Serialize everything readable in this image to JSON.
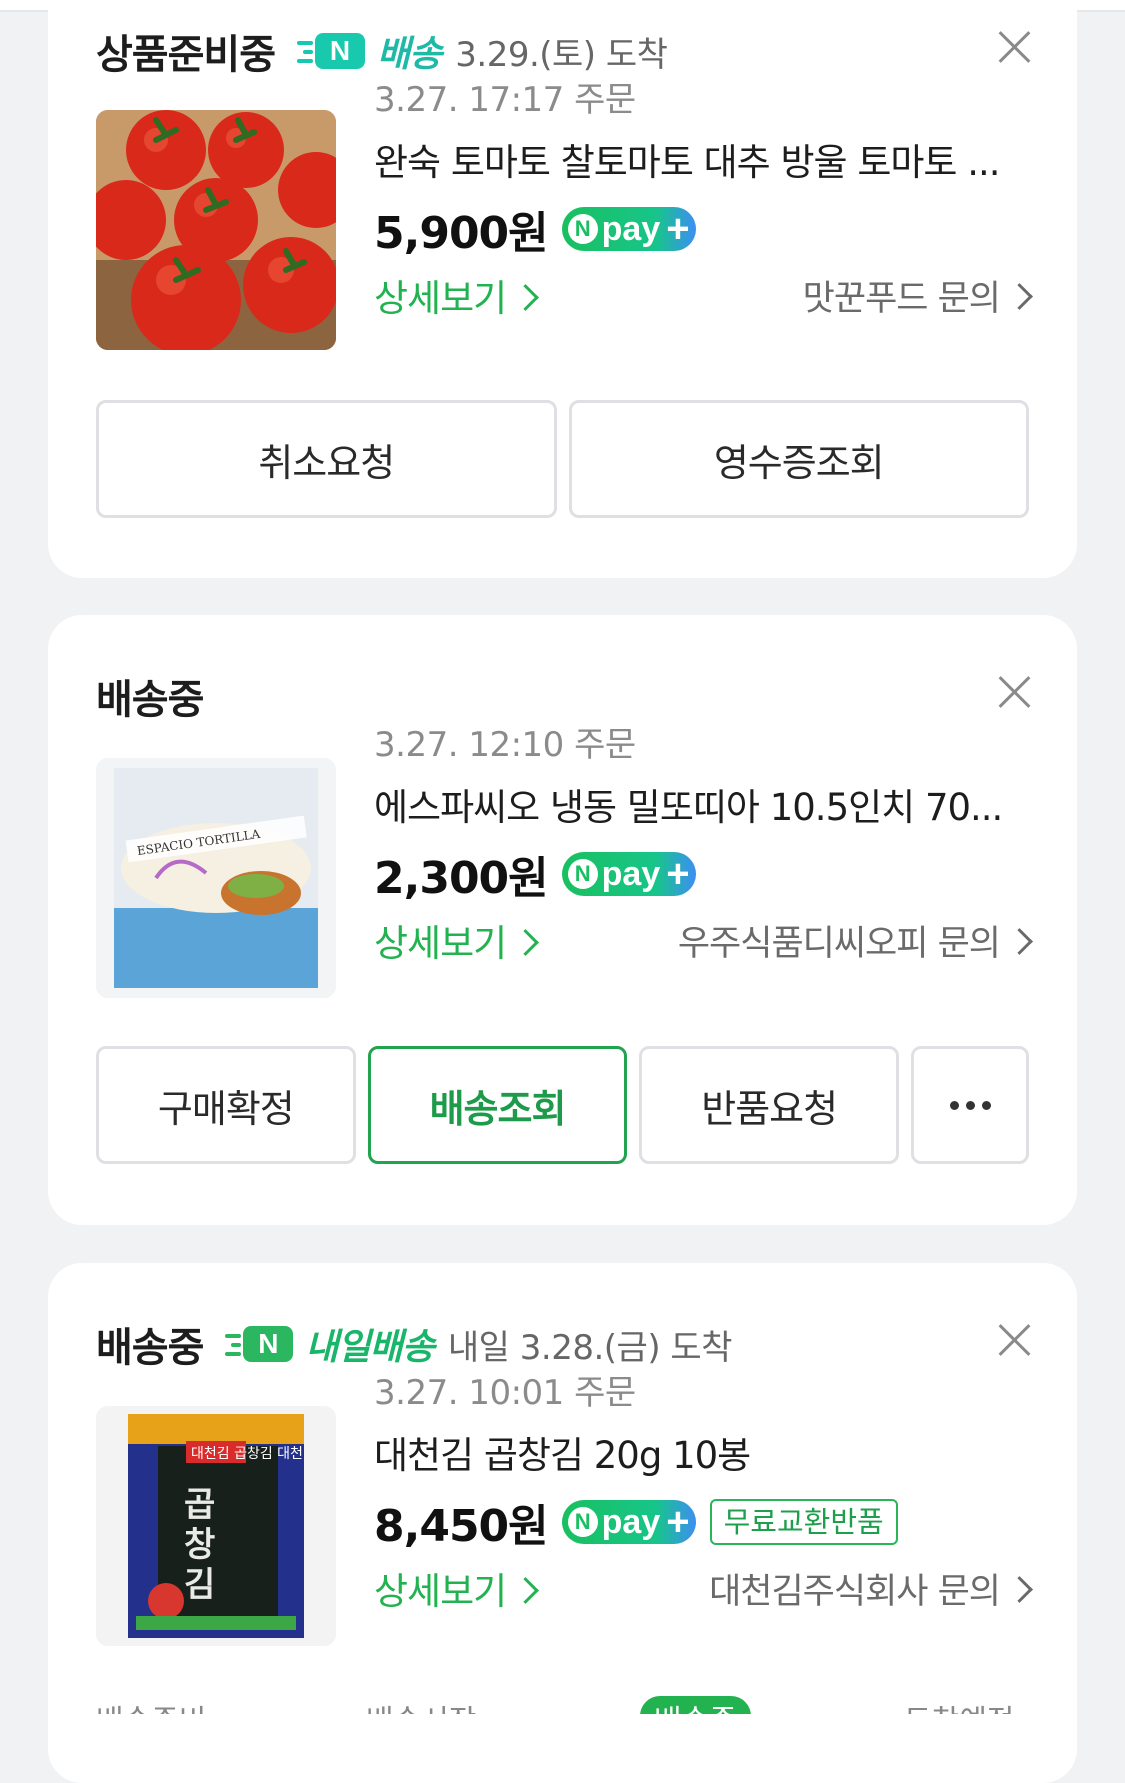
{
  "orders": [
    {
      "status": "상품준비중",
      "delivery_badge": "배송",
      "arrival": "3.29.(토) 도착",
      "order_time": "3.27. 17:17 주문",
      "product_name": "완숙 토마토 찰토마토 대추 방울 토마토 ...",
      "price": "5,900원",
      "detail_label": "상세보기",
      "seller_inquiry": "맛꾼푸드 문의",
      "buttons": [
        "취소요청",
        "영수증조회"
      ]
    },
    {
      "status": "배송중",
      "order_time": "3.27. 12:10 주문",
      "product_name": "에스파씨오 냉동 밀또띠아 10.5인치 70...",
      "price": "2,300원",
      "detail_label": "상세보기",
      "seller_inquiry": "우주식품디씨오피 문의",
      "buttons": [
        "구매확정",
        "배송조회",
        "반품요청"
      ],
      "packaging_text": "ESPACIO TORTILLA"
    },
    {
      "status": "배송중",
      "delivery_badge": "내일배송",
      "arrival": "내일 3.28.(금) 도착",
      "order_time": "3.27. 10:01 주문",
      "product_name": "대천김 곱창김 20g 10봉",
      "price": "8,450원",
      "extra_badge": "무료교환반품",
      "detail_label": "상세보기",
      "seller_inquiry": "대천김주식회사 문의",
      "packaging_text": "대천김 곱창김 대천"
    }
  ],
  "npay": {
    "n": "N",
    "label": "pay",
    "plus": "+"
  },
  "ship_icon_letter": "N",
  "bottom_steps": [
    "배송준비",
    "배송시작",
    "배송중",
    "도착예정"
  ],
  "colors": {
    "accent_green": "#22b24f",
    "npay_green": "#19c05f",
    "teal": "#1fb9a8"
  },
  "icons": {
    "close": "close-icon",
    "chevron": "chevron-right-icon",
    "more": "more-icon",
    "delivery": "delivery-truck-icon"
  }
}
